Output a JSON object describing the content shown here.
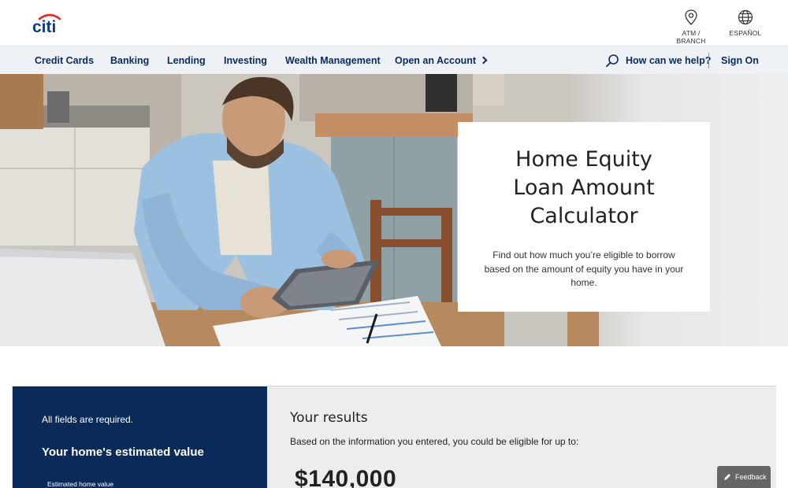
{
  "brand": {
    "name": "citi"
  },
  "utility": {
    "atm_label": "ATM / BRANCH",
    "espanol_label": "ESPAÑOL"
  },
  "nav": {
    "items": [
      {
        "label": "Credit Cards"
      },
      {
        "label": "Banking"
      },
      {
        "label": "Lending"
      },
      {
        "label": "Investing"
      },
      {
        "label": "Wealth Management"
      },
      {
        "label": "Open an Account"
      }
    ],
    "help_label": "How can we help?",
    "sign_on_label": "Sign On"
  },
  "hero": {
    "title_lines": [
      "Home Equity",
      "Loan Amount",
      "Calculator"
    ],
    "description": "Find out how much you’re eligible to borrow based on the amount of equity you have in your home."
  },
  "calculator": {
    "required_note": "All fields are required.",
    "section_title": "Your home's estimated value",
    "field_label": "Estimated home value",
    "results_title": "Your results",
    "results_description": "Based on the information you entered, you could be eligible for up to:",
    "result_amount": "$140,000"
  },
  "feedback": {
    "label": "Feedback"
  },
  "colors": {
    "brand_blue": "#0b2b63",
    "brand_red": "#e3262b",
    "panel_navy": "#0a2a5a",
    "nav_bg": "#eef2f6",
    "results_bg": "#ededed"
  },
  "icons": [
    "location-pin-icon",
    "globe-icon",
    "search-icon",
    "chevron-right-icon",
    "feedback-icon"
  ]
}
